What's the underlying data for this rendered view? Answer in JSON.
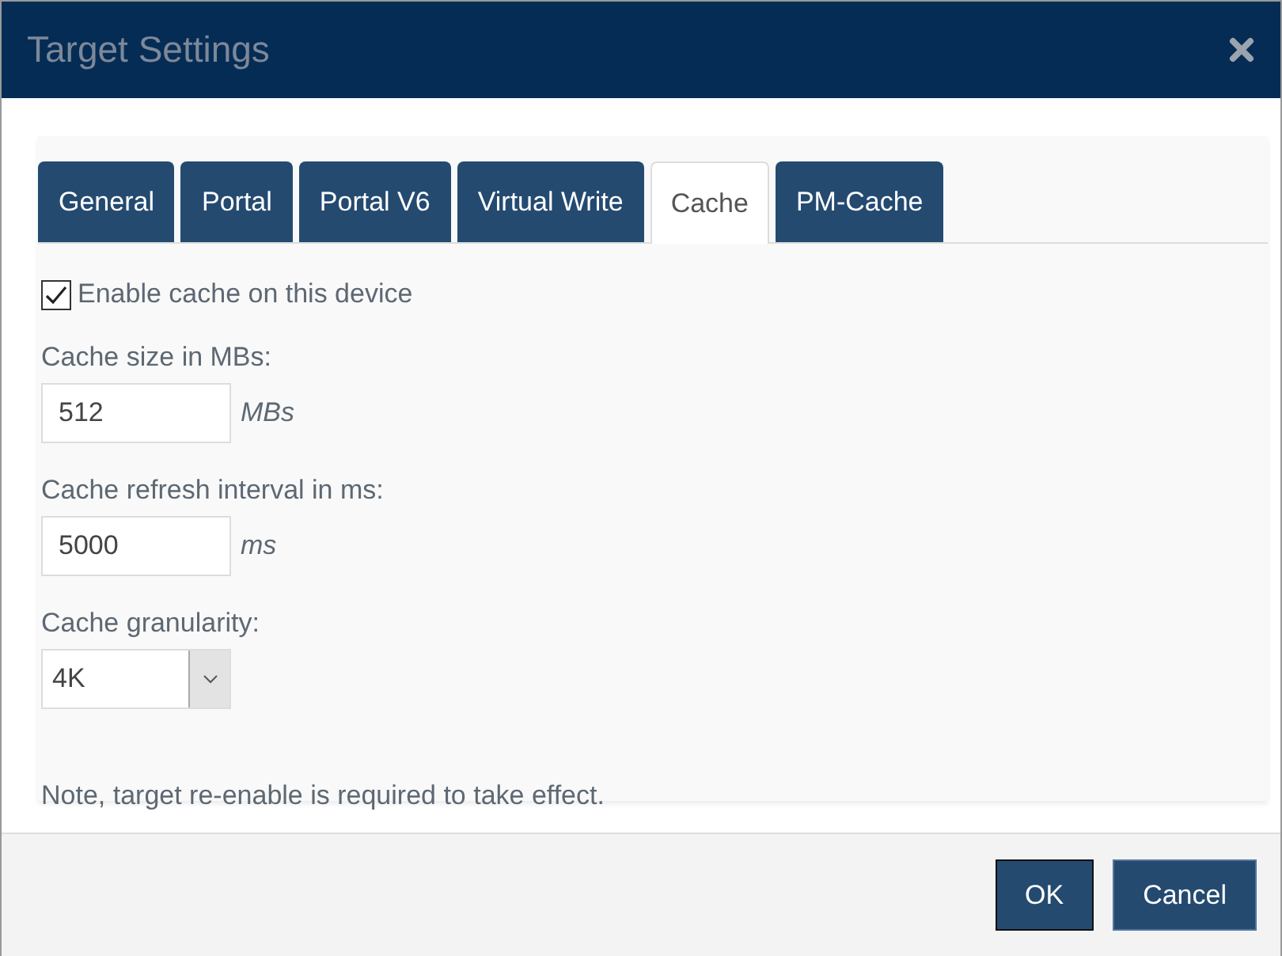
{
  "window": {
    "title": "Target Settings"
  },
  "tabs": [
    {
      "label": "General",
      "selected": false
    },
    {
      "label": "Portal",
      "selected": false
    },
    {
      "label": "Portal V6",
      "selected": false
    },
    {
      "label": "Virtual Write",
      "selected": false
    },
    {
      "label": "Cache",
      "selected": true
    },
    {
      "label": "PM-Cache",
      "selected": false
    }
  ],
  "enable_cache": {
    "label": "Enable cache on this device",
    "checked": true
  },
  "fields": [
    {
      "kind": "input",
      "label": "Cache size in MBs:",
      "value": "512",
      "unit": "MBs"
    },
    {
      "kind": "input",
      "label": "Cache refresh interval in ms:",
      "value": "5000",
      "unit": "ms"
    },
    {
      "kind": "select",
      "label": "Cache granularity:",
      "value": "4K"
    }
  ],
  "note": "Note, target re-enable is required to take effect.",
  "buttons": [
    {
      "label": "OK"
    },
    {
      "label": "Cancel"
    }
  ]
}
